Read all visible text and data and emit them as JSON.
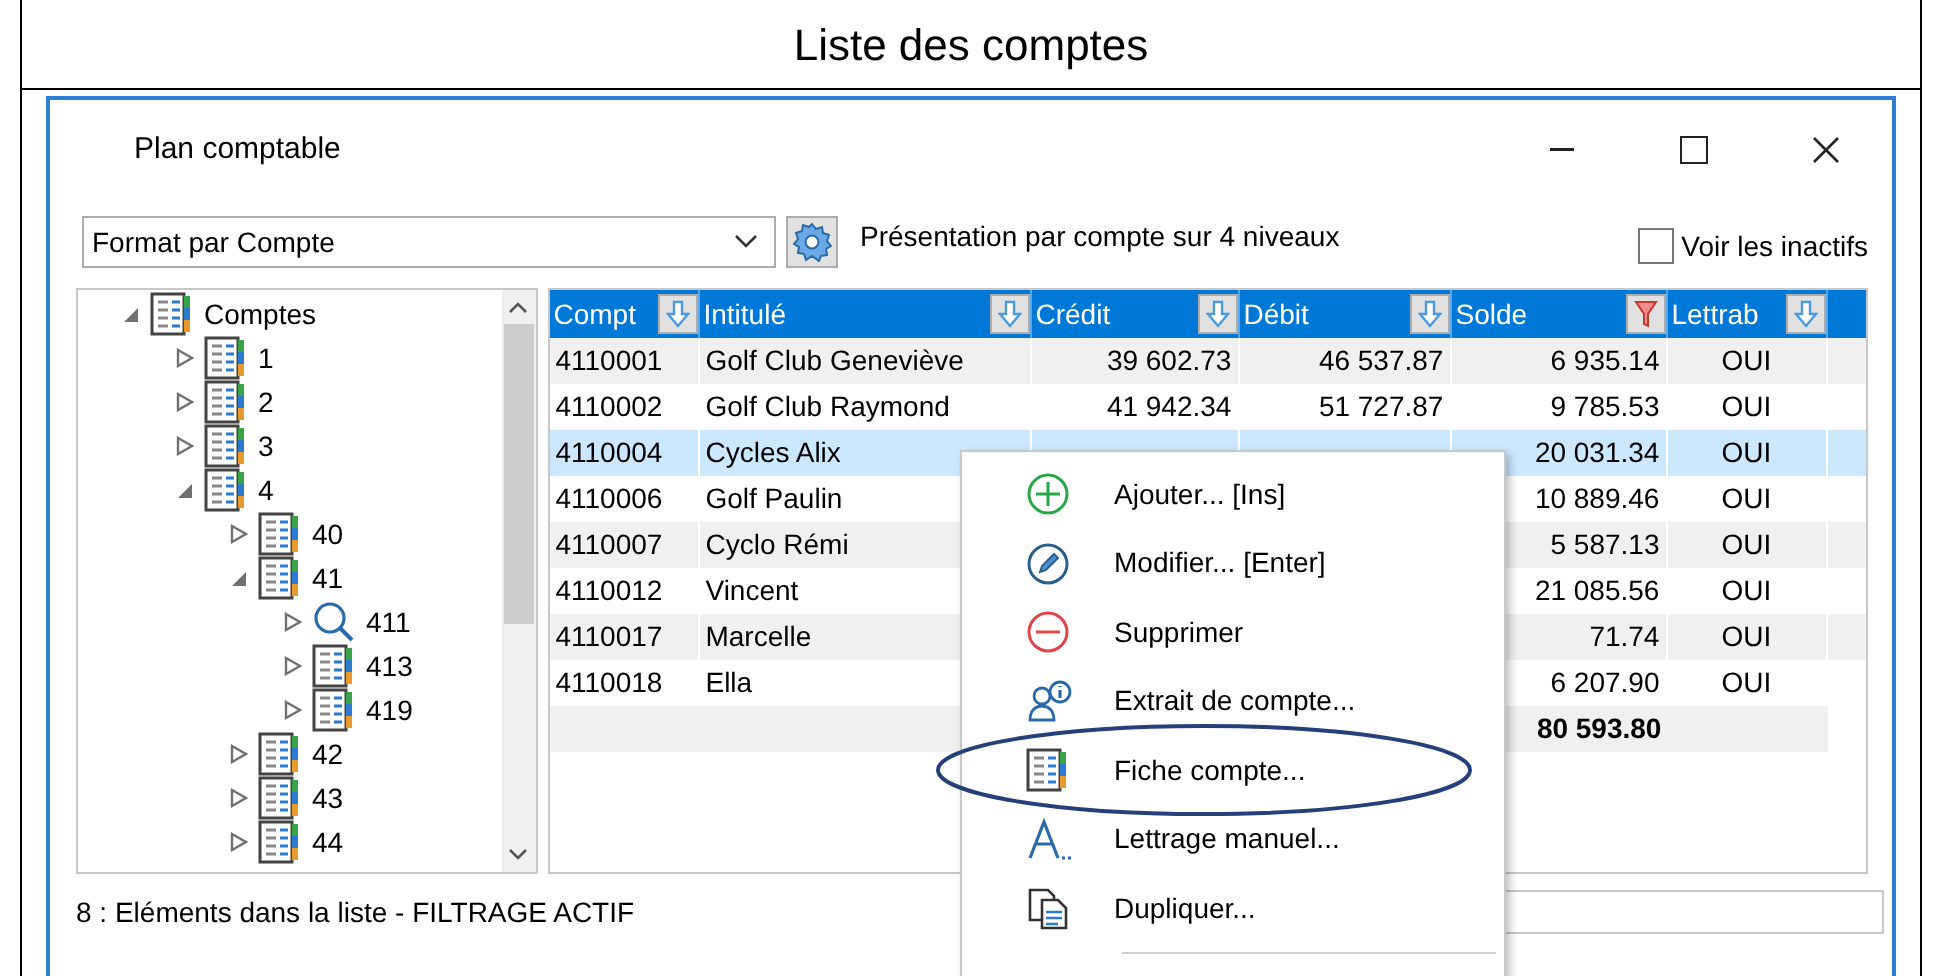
{
  "caption": "Liste des comptes",
  "window": {
    "title": "Plan comptable"
  },
  "toolbar": {
    "format": "Format par Compte",
    "description": "Présentation par compte sur 4 niveaux",
    "show_inactive": {
      "label": "Voir les inactifs",
      "checked": false
    }
  },
  "tree": {
    "items": [
      {
        "label": "Comptes",
        "kind": "account",
        "expanded": true,
        "children": [
          {
            "label": "1",
            "kind": "account",
            "expanded": false
          },
          {
            "label": "2",
            "kind": "account",
            "expanded": false
          },
          {
            "label": "3",
            "kind": "account",
            "expanded": false
          },
          {
            "label": "4",
            "kind": "account",
            "expanded": true,
            "children": [
              {
                "label": "40",
                "kind": "account",
                "expanded": false
              },
              {
                "label": "41",
                "kind": "account",
                "expanded": true,
                "children": [
                  {
                    "label": "411",
                    "kind": "search",
                    "expanded": false
                  },
                  {
                    "label": "413",
                    "kind": "account",
                    "expanded": false
                  },
                  {
                    "label": "419",
                    "kind": "account",
                    "expanded": false
                  }
                ]
              },
              {
                "label": "42",
                "kind": "account",
                "expanded": false
              },
              {
                "label": "43",
                "kind": "account",
                "expanded": false
              },
              {
                "label": "44",
                "kind": "account",
                "expanded": false
              }
            ]
          }
        ]
      }
    ]
  },
  "table": {
    "columns": [
      {
        "label": "Compt",
        "filtered": false
      },
      {
        "label": "Intitulé",
        "filtered": false
      },
      {
        "label": "Crédit",
        "filtered": false
      },
      {
        "label": "Débit",
        "filtered": false
      },
      {
        "label": "Solde",
        "filtered": true
      },
      {
        "label": "Lettrab",
        "filtered": false
      }
    ],
    "rows": [
      {
        "compte": "4110001",
        "intitule": "Golf Club Geneviève",
        "credit": "39 602.73",
        "debit": "46 537.87",
        "solde": "6 935.14",
        "lettrage": "OUI",
        "selected": false
      },
      {
        "compte": "4110002",
        "intitule": "Golf Club Raymond",
        "credit": "41 942.34",
        "debit": "51 727.87",
        "solde": "9 785.53",
        "lettrage": "OUI",
        "selected": false
      },
      {
        "compte": "4110004",
        "intitule": "Cycles Alix",
        "solde": "20 031.34",
        "lettrage": "OUI",
        "selected": true
      },
      {
        "compte": "4110006",
        "intitule": "Golf Paulin",
        "solde": "10 889.46",
        "lettrage": "OUI",
        "selected": false
      },
      {
        "compte": "4110007",
        "intitule": "Cyclo Rémi",
        "solde": "5 587.13",
        "lettrage": "OUI",
        "selected": false
      },
      {
        "compte": "4110012",
        "intitule": "Vincent",
        "solde": "21 085.56",
        "lettrage": "OUI",
        "selected": false
      },
      {
        "compte": "4110017",
        "intitule": "Marcelle",
        "solde": "71.74",
        "lettrage": "OUI",
        "selected": false
      },
      {
        "compte": "4110018",
        "intitule": "Ella",
        "solde": "6 207.90",
        "lettrage": "OUI",
        "selected": false
      }
    ],
    "total": {
      "solde": "80 593.80"
    }
  },
  "status_bar": {
    "text": "8 : Eléments dans la liste - FILTRAGE ACTIF"
  },
  "context_menu": {
    "items": [
      {
        "label": "Ajouter... [Ins]",
        "kind": "add",
        "circled": false
      },
      {
        "label": "Modifier... [Enter]",
        "kind": "edit",
        "circled": false
      },
      {
        "label": "Supprimer",
        "kind": "delete",
        "circled": false
      },
      {
        "label": "Extrait de compte...",
        "kind": "extract",
        "circled": false
      },
      {
        "label": "Fiche compte...",
        "kind": "sheet",
        "circled": true
      },
      {
        "label": "Lettrage manuel...",
        "kind": "lettering",
        "circled": false
      },
      {
        "label": "Dupliquer...",
        "kind": "duplicate",
        "circled": false
      }
    ]
  }
}
